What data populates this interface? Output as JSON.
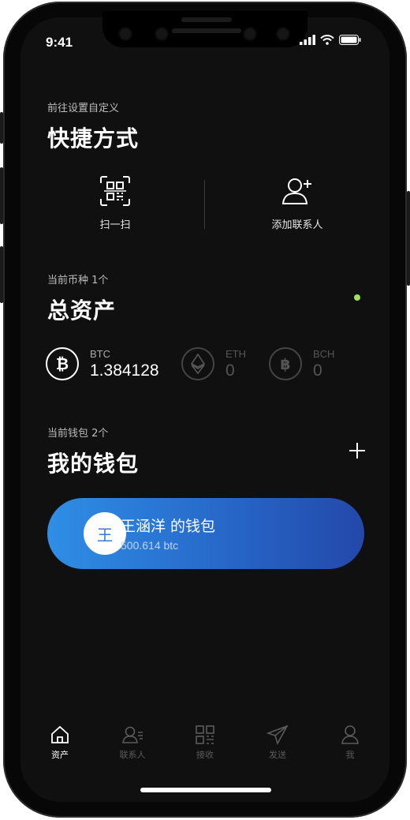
{
  "status_bar": {
    "time": "9:41"
  },
  "shortcuts": {
    "caption": "前往设置自定义",
    "title": "快捷方式",
    "items": [
      {
        "label": "扫一扫",
        "icon": "qr-scan-icon"
      },
      {
        "label": "添加联系人",
        "icon": "add-contact-icon"
      }
    ]
  },
  "assets": {
    "caption": "当前币种 1个",
    "title": "总资产",
    "coins": [
      {
        "symbol": "BTC",
        "amount": "1.384128",
        "icon": "bitcoin-icon",
        "active": true
      },
      {
        "symbol": "ETH",
        "amount": "0",
        "icon": "ethereum-icon",
        "active": false
      },
      {
        "symbol": "BCH",
        "amount": "0",
        "icon": "bitcoin-cash-icon",
        "active": false
      }
    ]
  },
  "wallets": {
    "caption": "当前钱包 2个",
    "title": "我的钱包",
    "items": [
      {
        "avatar": "王",
        "name": "王涵洋 的钱包",
        "balance": "500.614 btc"
      }
    ]
  },
  "tabbar": {
    "tabs": [
      {
        "label": "资产",
        "icon": "home-icon",
        "active": true
      },
      {
        "label": "联系人",
        "icon": "contacts-icon",
        "active": false
      },
      {
        "label": "接收",
        "icon": "receive-qr-icon",
        "active": false
      },
      {
        "label": "发送",
        "icon": "send-icon",
        "active": false
      },
      {
        "label": "我",
        "icon": "profile-icon",
        "active": false
      }
    ]
  },
  "colors": {
    "background": "#101010",
    "wallet_gradient_start": "#2f8ee6",
    "wallet_gradient_end": "#2348a9",
    "status_dot": "#9be35c",
    "inactive": "#5b5b5b"
  }
}
